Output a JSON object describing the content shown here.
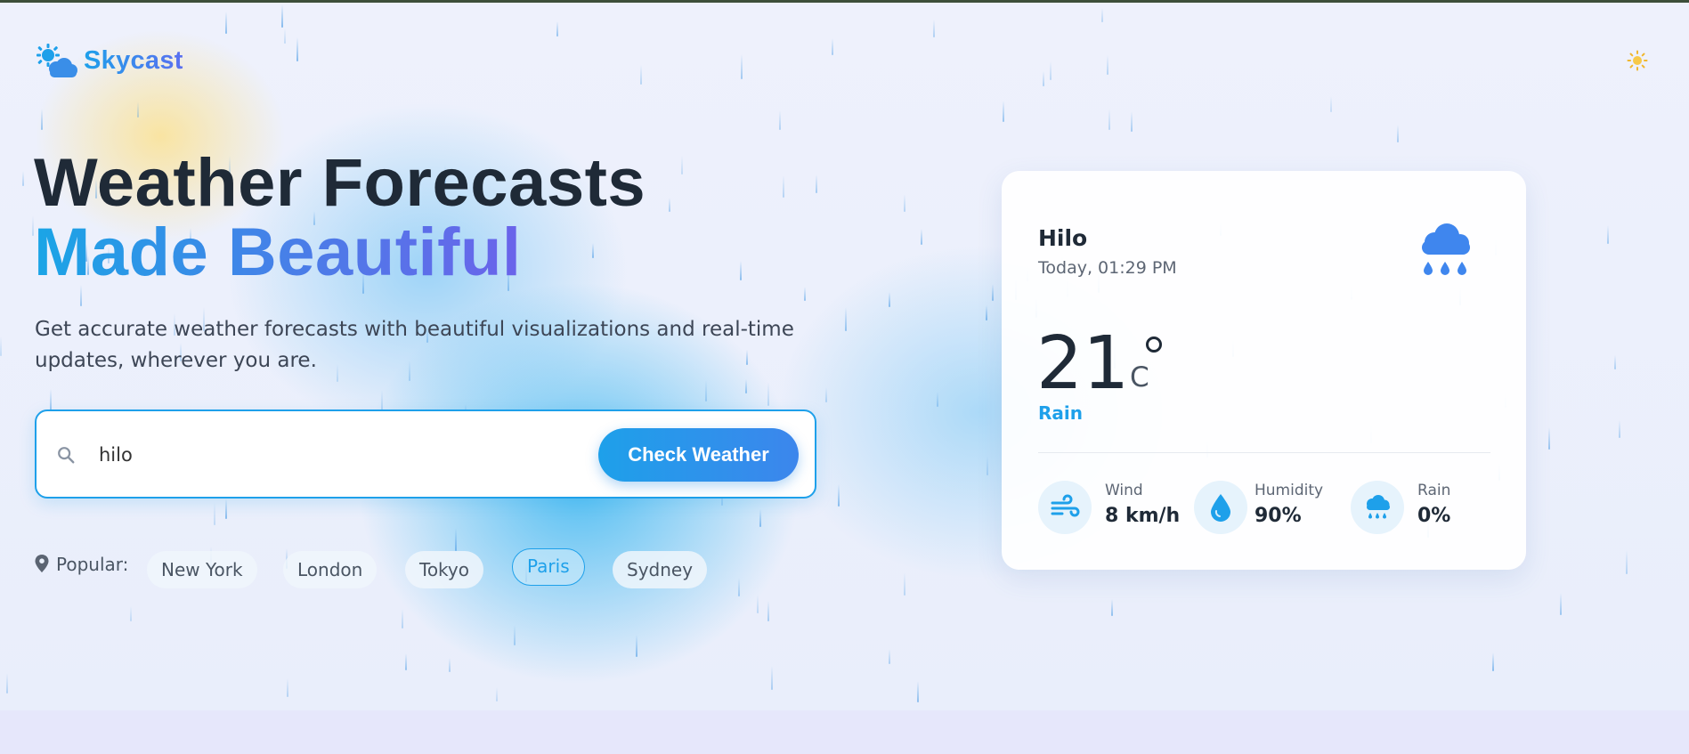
{
  "brand": {
    "name": "Skycast"
  },
  "hero": {
    "headline_line1": "Weather Forecasts",
    "headline_line2": "Made Beautiful",
    "subtitle": "Get accurate weather forecasts with beautiful visualizations and real-time updates, wherever you are."
  },
  "search": {
    "value": "hilo",
    "placeholder": "",
    "button_label": "Check Weather"
  },
  "popular": {
    "label": "Popular:",
    "cities": [
      "New York",
      "London",
      "Tokyo",
      "Paris",
      "Sydney"
    ],
    "active": "Paris"
  },
  "weather": {
    "city": "Hilo",
    "date_time": "Today, 01:29 PM",
    "temperature": "21",
    "unit": "C",
    "condition": "Rain",
    "condition_icon": "rain-cloud-icon",
    "metrics": [
      {
        "label": "Wind",
        "value": "8 km/h",
        "icon": "wind-icon"
      },
      {
        "label": "Humidity",
        "value": "90%",
        "icon": "humidity-drop-icon"
      },
      {
        "label": "Rain",
        "value": "0%",
        "icon": "rain-cloud-icon"
      }
    ]
  },
  "colors": {
    "accent": "#1ea0ea",
    "accent_secondary": "#6b63ea",
    "text_dark": "#1f2a37",
    "sun": "#f7c948"
  },
  "icons": {
    "logo": "sun-cloud-icon",
    "theme_toggle": "sun-icon",
    "search": "search-icon",
    "popular": "map-pin-icon"
  }
}
